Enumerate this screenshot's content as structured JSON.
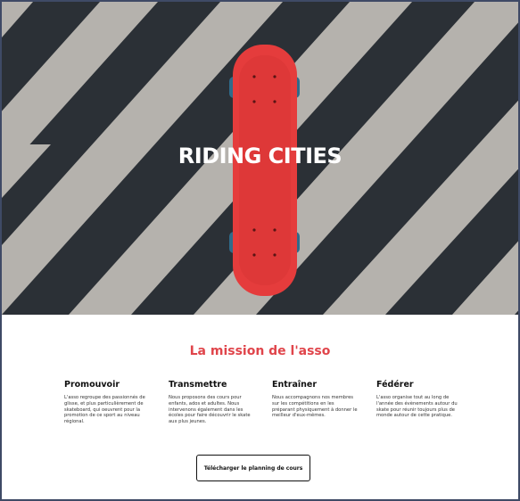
{
  "hero": {
    "title": "RIDING CITIES"
  },
  "mission": {
    "title": "La mission de l'asso"
  },
  "columns": [
    {
      "title": "Promouvoir",
      "text": "L'asso regroupe des passionnés de glisse, et plus particulièrement de skateboard, qui oeuvrent pour la promotion de ce sport au niveau régional."
    },
    {
      "title": "Transmettre",
      "text": "Nous proposons des cours pour enfants, ados et adultes. Nous intervenons également dans les écoles pour faire découvrir le skate aux plus jeunes."
    },
    {
      "title": "Entraîner",
      "text": "Nous accompagnons nos membres sur les compétitions en les préparant physiquement à donner le meilleur d'eux-mêmes."
    },
    {
      "title": "Fédérer",
      "text": "L'asso organise tout au long de l'année des évènements autour du skate pour réunir toujours plus de monde autour de cette pratique."
    }
  ],
  "cta": {
    "label": "Télécharger le planning de cours"
  },
  "colors": {
    "accent": "#e0454b",
    "skateboard": "#e53c3c",
    "wheels": "#2f6b8a",
    "asphalt": "#2b3036",
    "stripes": "#bdbab4"
  }
}
